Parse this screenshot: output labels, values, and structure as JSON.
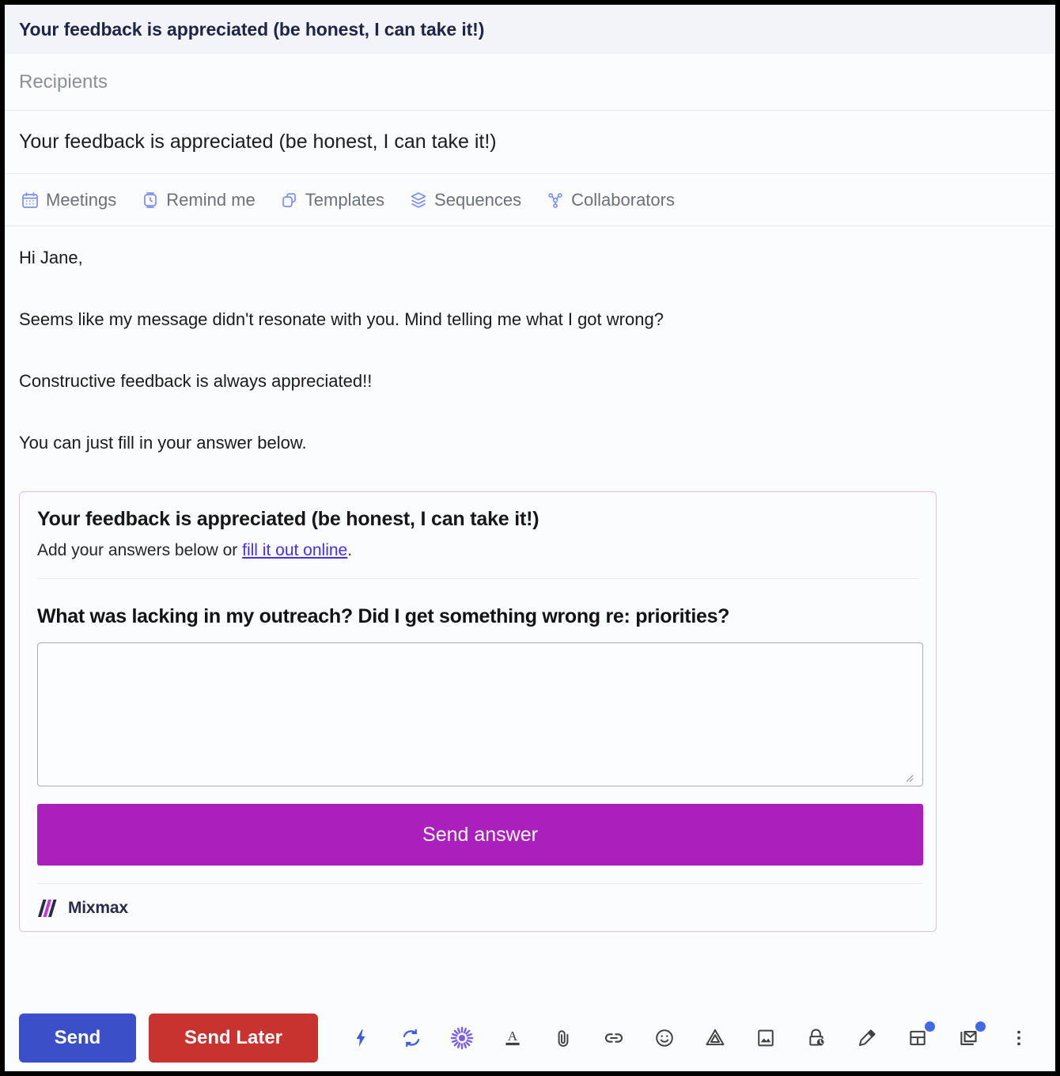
{
  "header": {
    "title": "Your feedback is appreciated (be honest, I can take it!)"
  },
  "recipients": {
    "placeholder": "Recipients",
    "value": ""
  },
  "subject": {
    "value": "Your feedback is appreciated (be honest, I can take it!)"
  },
  "feature_bar": {
    "items": [
      {
        "label": "Meetings",
        "icon": "calendar-icon"
      },
      {
        "label": "Remind me",
        "icon": "alarm-clock-icon"
      },
      {
        "label": "Templates",
        "icon": "copy-icon"
      },
      {
        "label": "Sequences",
        "icon": "layers-icon"
      },
      {
        "label": "Collaborators",
        "icon": "people-icon"
      }
    ]
  },
  "mail_body": {
    "paragraphs": [
      "Hi Jane,",
      "Seems like my message didn't resonate with you. Mind telling me what I got wrong?",
      "Constructive feedback is always appreciated!!",
      "You can just fill in your answer below."
    ]
  },
  "survey_card": {
    "title": "Your feedback is appreciated (be honest, I can take it!)",
    "subtitle_before_link": "Add your answers below or ",
    "link_text": "fill it out online",
    "subtitle_after_link": ".",
    "question": "What was lacking in my outreach? Did I get something wrong re: priorities?",
    "answer_value": "",
    "answer_placeholder": "",
    "submit_label": "Send answer",
    "brand_name": "Mixmax"
  },
  "bottom_bar": {
    "send_label": "Send",
    "send_later_label": "Send Later",
    "tools": [
      {
        "name": "lightning-icon",
        "badge": false
      },
      {
        "name": "sync-icon",
        "badge": false
      },
      {
        "name": "sparkle-icon",
        "badge": false
      },
      {
        "name": "text-color-icon",
        "badge": false
      },
      {
        "name": "paperclip-icon",
        "badge": false
      },
      {
        "name": "link-icon",
        "badge": false
      },
      {
        "name": "emoji-icon",
        "badge": false
      },
      {
        "name": "google-drive-icon",
        "badge": false
      },
      {
        "name": "image-icon",
        "badge": false
      },
      {
        "name": "lock-clock-icon",
        "badge": false
      },
      {
        "name": "marker-pen-icon",
        "badge": false
      },
      {
        "name": "layout-icon",
        "badge": true
      },
      {
        "name": "mail-track-icon",
        "badge": true
      },
      {
        "name": "more-vertical-icon",
        "badge": false
      }
    ]
  },
  "colors": {
    "header_bg": "#f3f4fa",
    "header_title": "#202447",
    "feature_icon": "#7b8ef0",
    "send_blue": "#3b4fc8",
    "send_later_red": "#c8322f",
    "survey_border": "#e2bfe9",
    "survey_button": "#ab1fbd",
    "link_violet": "#4530ec",
    "badge_blue": "#4169e8",
    "sparkle_purple": "#7b5ce8",
    "toolbar_icon_dark": "#3f4340"
  }
}
